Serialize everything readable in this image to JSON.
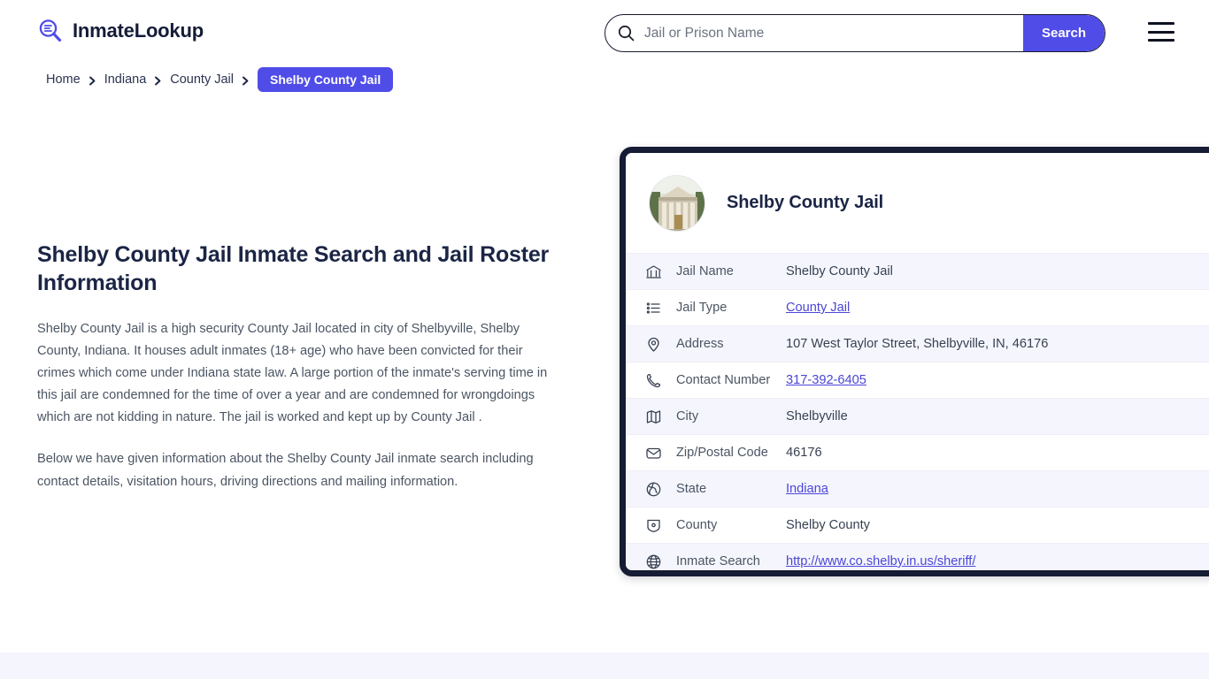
{
  "header": {
    "brand_name": "InmateLookup",
    "brand_icon": "search-list-logo-icon",
    "menu_icon": "hamburger-menu-icon",
    "accent_color": "#4f4ce8",
    "dark_color": "#151c33"
  },
  "search": {
    "placeholder": "Jail or Prison Name",
    "value": "",
    "button_label": "Search",
    "icon": "search-icon"
  },
  "breadcrumb": {
    "items": [
      {
        "label": "Home",
        "active": false
      },
      {
        "label": "Indiana",
        "active": false
      },
      {
        "label": "County Jail",
        "active": false
      },
      {
        "label": "Shelby County Jail",
        "active": true
      }
    ]
  },
  "main": {
    "title": "Shelby County Jail Inmate Search and Jail Roster Information",
    "paragraph_1": "Shelby County Jail is a high security County Jail located in city of Shelbyville, Shelby County, Indiana. It houses adult inmates (18+ age) who have been convicted for their crimes which come under Indiana state law. A large portion of the inmate's serving time in this jail are condemned for the time of over a year and are condemned for wrongdoings which are not kidding in nature. The jail is worked and kept up by County Jail .",
    "paragraph_2": "Below we have given information about the Shelby County Jail inmate search including contact details, visitation hours, driving directions and mailing information."
  },
  "card": {
    "title": "Shelby County Jail",
    "avatar_icon": "courthouse-photo",
    "rows": [
      {
        "icon": "bank-icon",
        "label": "Jail Name",
        "value": "Shelby County Jail",
        "link": false
      },
      {
        "icon": "list-icon",
        "label": "Jail Type",
        "value": "County Jail",
        "link": true
      },
      {
        "icon": "map-pin-icon",
        "label": "Address",
        "value": "107 West Taylor Street, Shelbyville, IN, 46176",
        "link": false
      },
      {
        "icon": "phone-icon",
        "label": "Contact Number",
        "value": "317-392-6405",
        "link": true
      },
      {
        "icon": "map-icon",
        "label": "City",
        "value": "Shelbyville",
        "link": false
      },
      {
        "icon": "envelope-icon",
        "label": "Zip/Postal Code",
        "value": "46176",
        "link": false
      },
      {
        "icon": "globe-icon",
        "label": "State",
        "value": "Indiana",
        "link": true
      },
      {
        "icon": "badge-icon",
        "label": "County",
        "value": "Shelby County",
        "link": false
      },
      {
        "icon": "web-globe-icon",
        "label": "Inmate Search",
        "value": "http://www.co.shelby.in.us/sheriff/",
        "link": true
      }
    ]
  }
}
